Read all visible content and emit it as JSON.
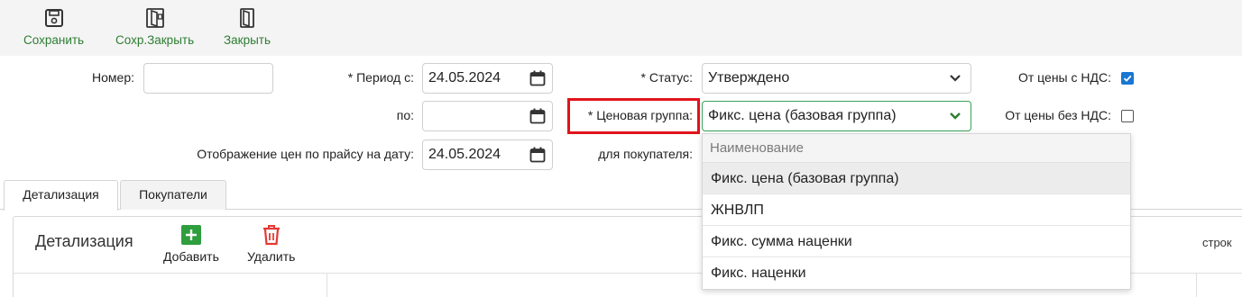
{
  "toolbar": {
    "save_label": "Сохранить",
    "save_close_label": "Сохр.Закрыть",
    "close_label": "Закрыть"
  },
  "form": {
    "number_label": "Номер:",
    "number_value": "",
    "period_from_label": "* Период с:",
    "period_from_value": "24.05.2024",
    "period_to_label": "по:",
    "period_to_value": "",
    "price_display_label": "Отображение цен по прайсу на дату:",
    "price_display_value": "24.05.2024",
    "status_label": "* Статус:",
    "status_value": "Утверждено",
    "price_group_label": "* Ценовая группа:",
    "price_group_value": "Фикс. цена (базовая группа)",
    "buyer_label": "для покупателя:",
    "vat_incl_label": "От цены с НДС:",
    "vat_incl_checked": true,
    "vat_excl_label": "От цены без НДС:",
    "vat_excl_checked": false
  },
  "tabs": [
    {
      "label": "Детализация",
      "active": true
    },
    {
      "label": "Покупатели",
      "active": false
    }
  ],
  "panel": {
    "title": "Детализация",
    "add_label": "Добавить",
    "delete_label": "Удалить",
    "rows_label": "строк"
  },
  "dropdown": {
    "header": "Наименование",
    "items": [
      {
        "label": "Фикс. цена (базовая группа)",
        "selected": true
      },
      {
        "label": "ЖНВЛП",
        "selected": false
      },
      {
        "label": "Фикс. сумма наценки",
        "selected": false
      },
      {
        "label": "Фикс. наценки",
        "selected": false
      }
    ]
  },
  "colors": {
    "toolbar_text": "#2e7d32",
    "highlight": "#e0141b",
    "checkbox": "#1976d2",
    "add_icon": "#2e9e3e",
    "delete_icon": "#e53935"
  },
  "icons": {
    "save": "floppy-disk-icon",
    "save_close": "door-save-icon",
    "close": "door-icon",
    "calendar": "calendar-icon",
    "chevron": "chevron-down-icon",
    "add": "plus-icon",
    "delete": "trash-icon"
  }
}
